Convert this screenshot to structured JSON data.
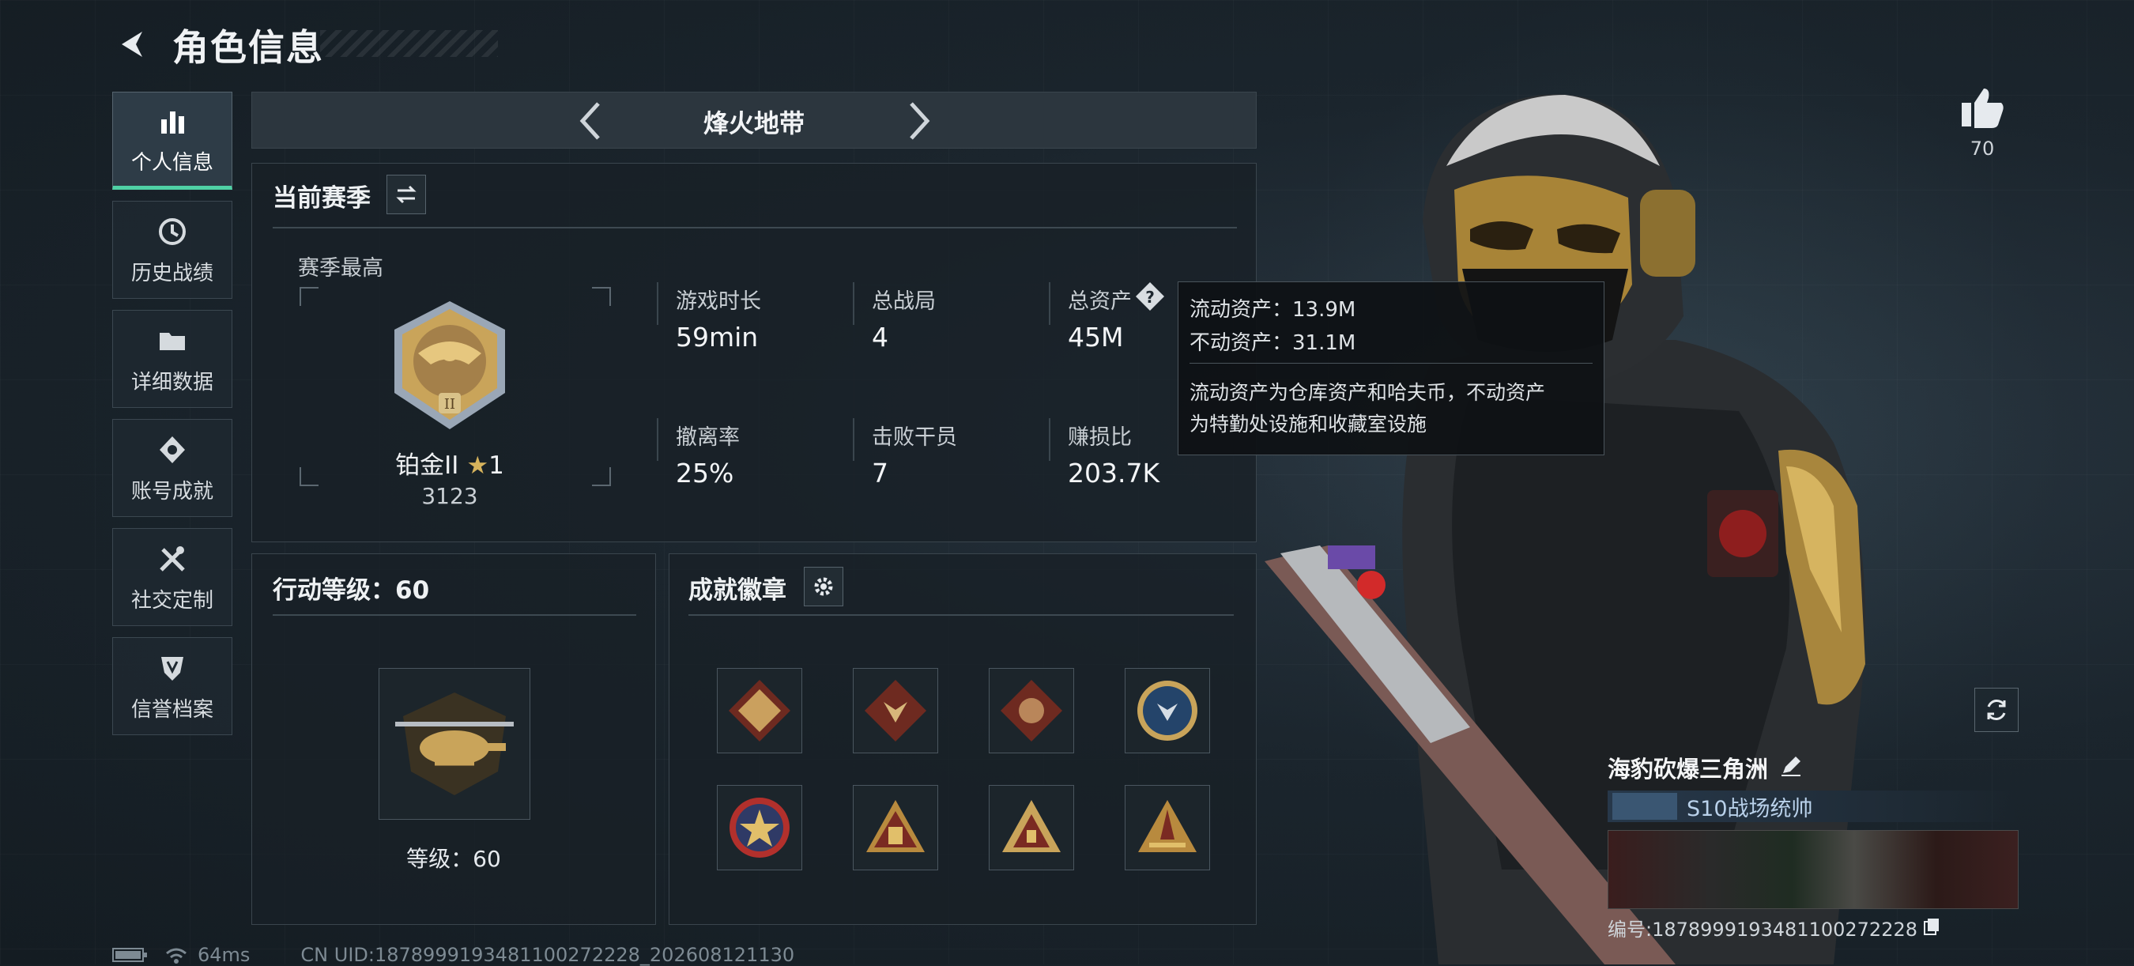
{
  "header": {
    "title": "角色信息"
  },
  "sidebar": {
    "items": [
      {
        "label": "个人信息",
        "icon": "bar-chart-icon",
        "active": true
      },
      {
        "label": "历史战绩",
        "icon": "clock-icon"
      },
      {
        "label": "详细数据",
        "icon": "folder-icon"
      },
      {
        "label": "账号成就",
        "icon": "diamond-badge-icon"
      },
      {
        "label": "社交定制",
        "icon": "tools-icon"
      },
      {
        "label": "信誉档案",
        "icon": "shield-icon"
      }
    ]
  },
  "mode_bar": {
    "title": "烽火地带"
  },
  "season": {
    "title": "当前赛季",
    "best_label": "赛季最高",
    "rank_name": "铂金II",
    "rank_stars": "1",
    "rank_points": "3123",
    "stats": [
      {
        "label": "游戏时长",
        "value": "59min"
      },
      {
        "label": "总战局",
        "value": "4"
      },
      {
        "label": "总资产",
        "value": "45M"
      },
      {
        "label": "撤离率",
        "value": "25%"
      },
      {
        "label": "击败干员",
        "value": "7"
      },
      {
        "label": "赚损比",
        "value": "203.7K"
      }
    ]
  },
  "tooltip": {
    "line1": "流动资产：13.9M",
    "line2": "不动资产：31.1M",
    "desc1": "流动资产为仓库资产和哈夫币，不动资产",
    "desc2": "为特勤处设施和收藏室设施"
  },
  "action_level": {
    "title": "行动等级：60",
    "level_text": "等级：60"
  },
  "achievements": {
    "title": "成就徽章",
    "badges": [
      "bull-badge",
      "wolf-badge",
      "dragon-badge",
      "wolf-round-badge",
      "star-emblem-badge",
      "figures-badge",
      "triangle-badge",
      "rocket-badge"
    ]
  },
  "footer": {
    "ping": "64ms",
    "uid": "CN UID:1878999193481100272228_202608121130"
  },
  "likes": {
    "count": "70"
  },
  "player": {
    "name": "海豹砍爆三角洲",
    "title": "S10战场统帅",
    "id": "编号:1878999193481100272228"
  },
  "colors": {
    "accent": "#4fd1a5",
    "gold": "#c9a45a",
    "panel_bg": "#182027"
  }
}
